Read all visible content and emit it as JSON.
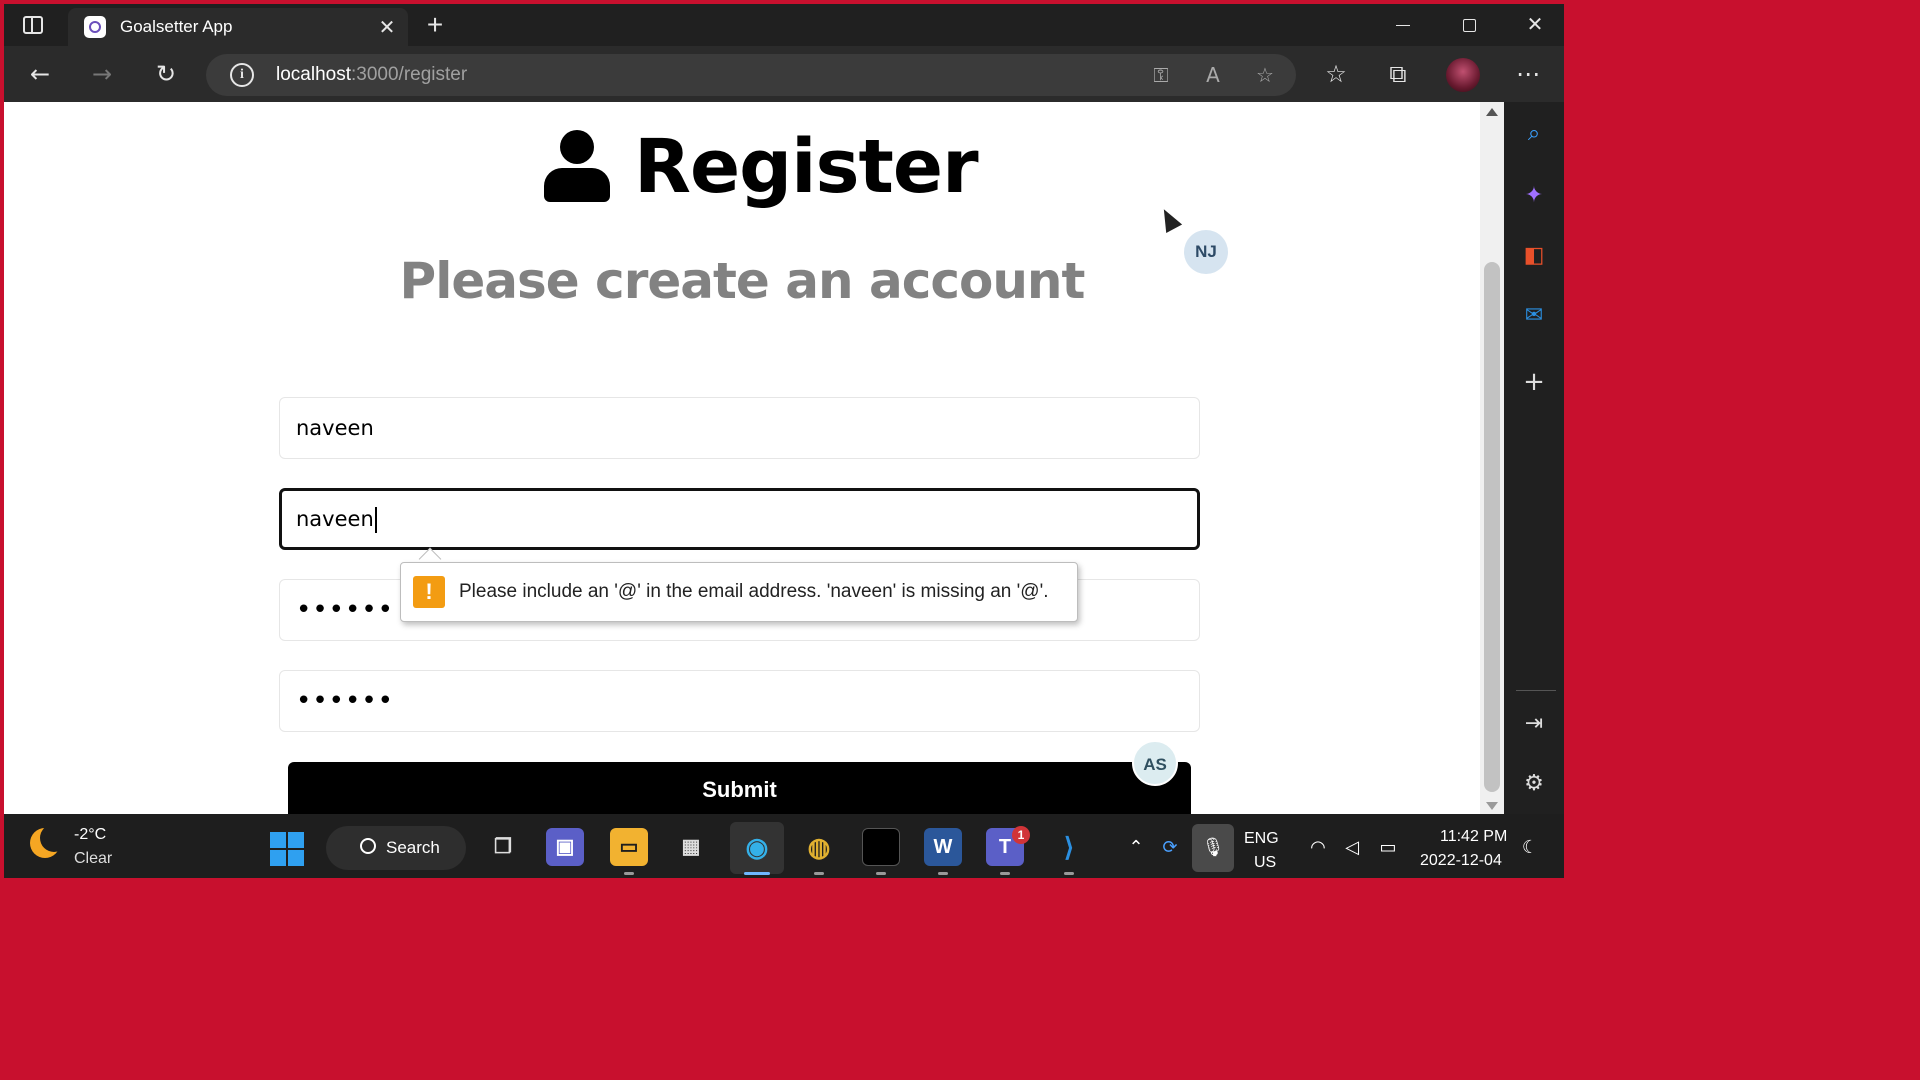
{
  "browser": {
    "tab_title": "Goalsetter App",
    "url_host": "localhost",
    "url_path": ":3000/register"
  },
  "page": {
    "title": "Register",
    "subtitle": "Please create an account",
    "fields": {
      "name_value": "naveen",
      "email_value": "naveen",
      "password_value": "••••••",
      "password_confirm_value": "••••••"
    },
    "validation_message": "Please include an '@' in the email address. 'naveen' is missing an '@'.",
    "submit_label": "Submit",
    "badge_top": "NJ",
    "badge_bottom": "AS"
  },
  "taskbar": {
    "weather_temp": "-2°C",
    "weather_condition": "Clear",
    "search_label": "Search",
    "teams_badge": "1",
    "language_top": "ENG",
    "language_bottom": "US",
    "time": "11:42 PM",
    "date": "2022-12-04"
  },
  "icons": {
    "sidebar": [
      "search-icon",
      "copilot-icon",
      "office-icon",
      "outlook-icon",
      "add-icon",
      "split-screen-icon",
      "settings-icon"
    ],
    "taskbar": [
      "start-icon",
      "task-view-icon",
      "chat-icon",
      "file-explorer-icon",
      "store-icon",
      "edge-icon",
      "chrome-icon",
      "terminal-icon",
      "word-icon",
      "teams-icon",
      "vscode-icon"
    ]
  },
  "colors": {
    "subtitle_gray": "#828282",
    "submit_bg": "#000000",
    "warning_orange": "#f39c12",
    "screen_border": "#c8102e"
  }
}
